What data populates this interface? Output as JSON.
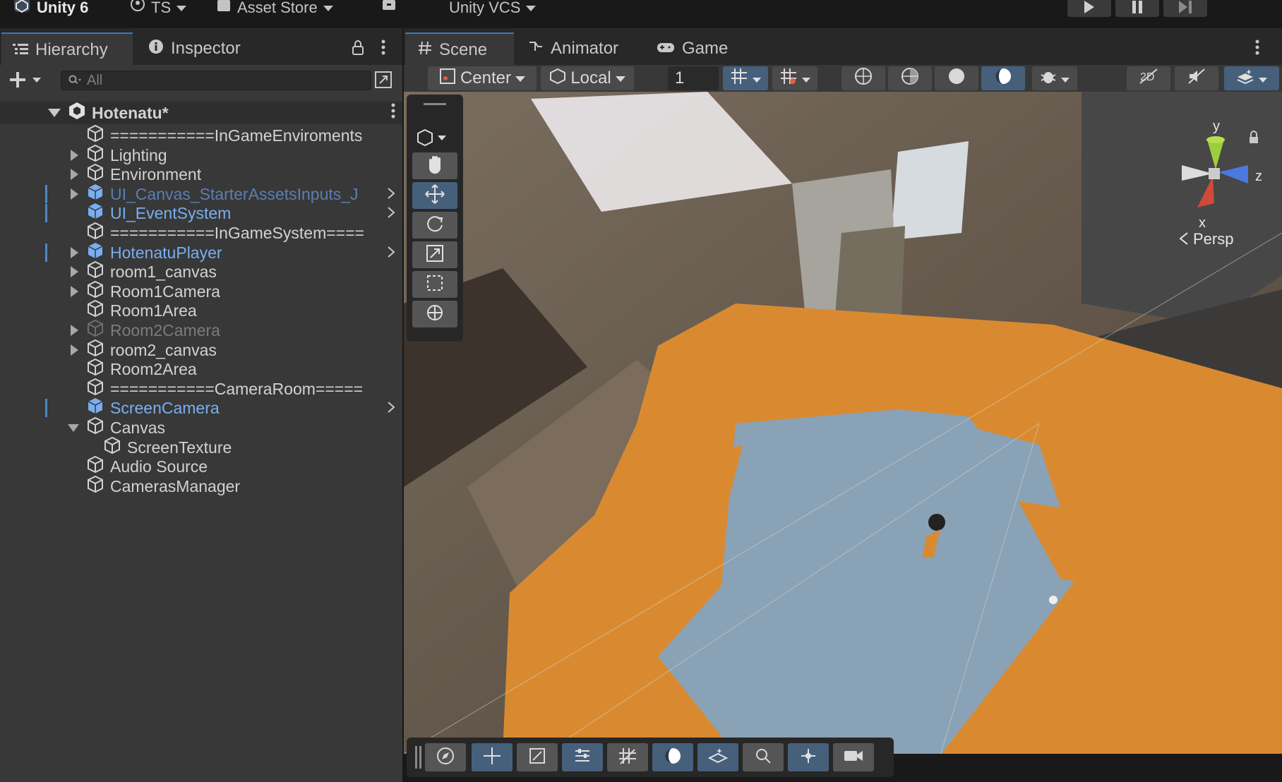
{
  "topbar": {
    "app_name": "Unity 6",
    "account": "TS",
    "asset_store": "Asset Store",
    "vcs": "Unity VCS"
  },
  "left_panel": {
    "tabs": [
      {
        "label": "Hierarchy"
      },
      {
        "label": "Inspector"
      }
    ],
    "search_placeholder": "All",
    "scene_name": "Hotenatu*",
    "items": [
      {
        "label": "===========InGameEnviroments",
        "expandable": false,
        "prefab": false
      },
      {
        "label": "Lighting",
        "expandable": true,
        "prefab": false
      },
      {
        "label": "Environment",
        "expandable": true,
        "prefab": false
      },
      {
        "label": "UI_Canvas_StarterAssetsInputs_J",
        "expandable": true,
        "prefab": true
      },
      {
        "label": "UI_EventSystem",
        "expandable": false,
        "prefab": true
      },
      {
        "label": "===========InGameSystem====",
        "expandable": false,
        "prefab": false
      },
      {
        "label": "HotenatuPlayer",
        "expandable": true,
        "prefab": true
      },
      {
        "label": "room1_canvas",
        "expandable": true,
        "prefab": false
      },
      {
        "label": "Room1Camera",
        "expandable": true,
        "prefab": false
      },
      {
        "label": "Room1Area",
        "expandable": false,
        "prefab": false
      },
      {
        "label": "Room2Camera",
        "expandable": true,
        "prefab": false,
        "disabled": true
      },
      {
        "label": "room2_canvas",
        "expandable": true,
        "prefab": false
      },
      {
        "label": "Room2Area",
        "expandable": false,
        "prefab": false
      },
      {
        "label": "===========CameraRoom=====",
        "expandable": false,
        "prefab": false
      },
      {
        "label": "ScreenCamera",
        "expandable": false,
        "prefab": true
      },
      {
        "label": "Canvas",
        "expandable": true,
        "expanded": true,
        "prefab": false
      },
      {
        "label": "ScreenTexture",
        "expandable": false,
        "prefab": false,
        "child": true
      },
      {
        "label": "Audio Source",
        "expandable": false,
        "prefab": false
      },
      {
        "label": "CamerasManager",
        "expandable": false,
        "prefab": false
      }
    ]
  },
  "scene_panel": {
    "tabs": [
      {
        "label": "Scene"
      },
      {
        "label": "Animator"
      },
      {
        "label": "Game"
      }
    ],
    "pivot_mode": "Center",
    "pivot_rotation": "Local",
    "grid_snap_value": "1",
    "gizmo": {
      "y": "y",
      "z": "z",
      "x": "x",
      "projection": "Persp"
    }
  },
  "colors": {
    "accent": "#46607c",
    "prefab_blue": "#79aef0",
    "floor_orange": "#d98a30",
    "floor_blue": "#8aa2b5"
  }
}
